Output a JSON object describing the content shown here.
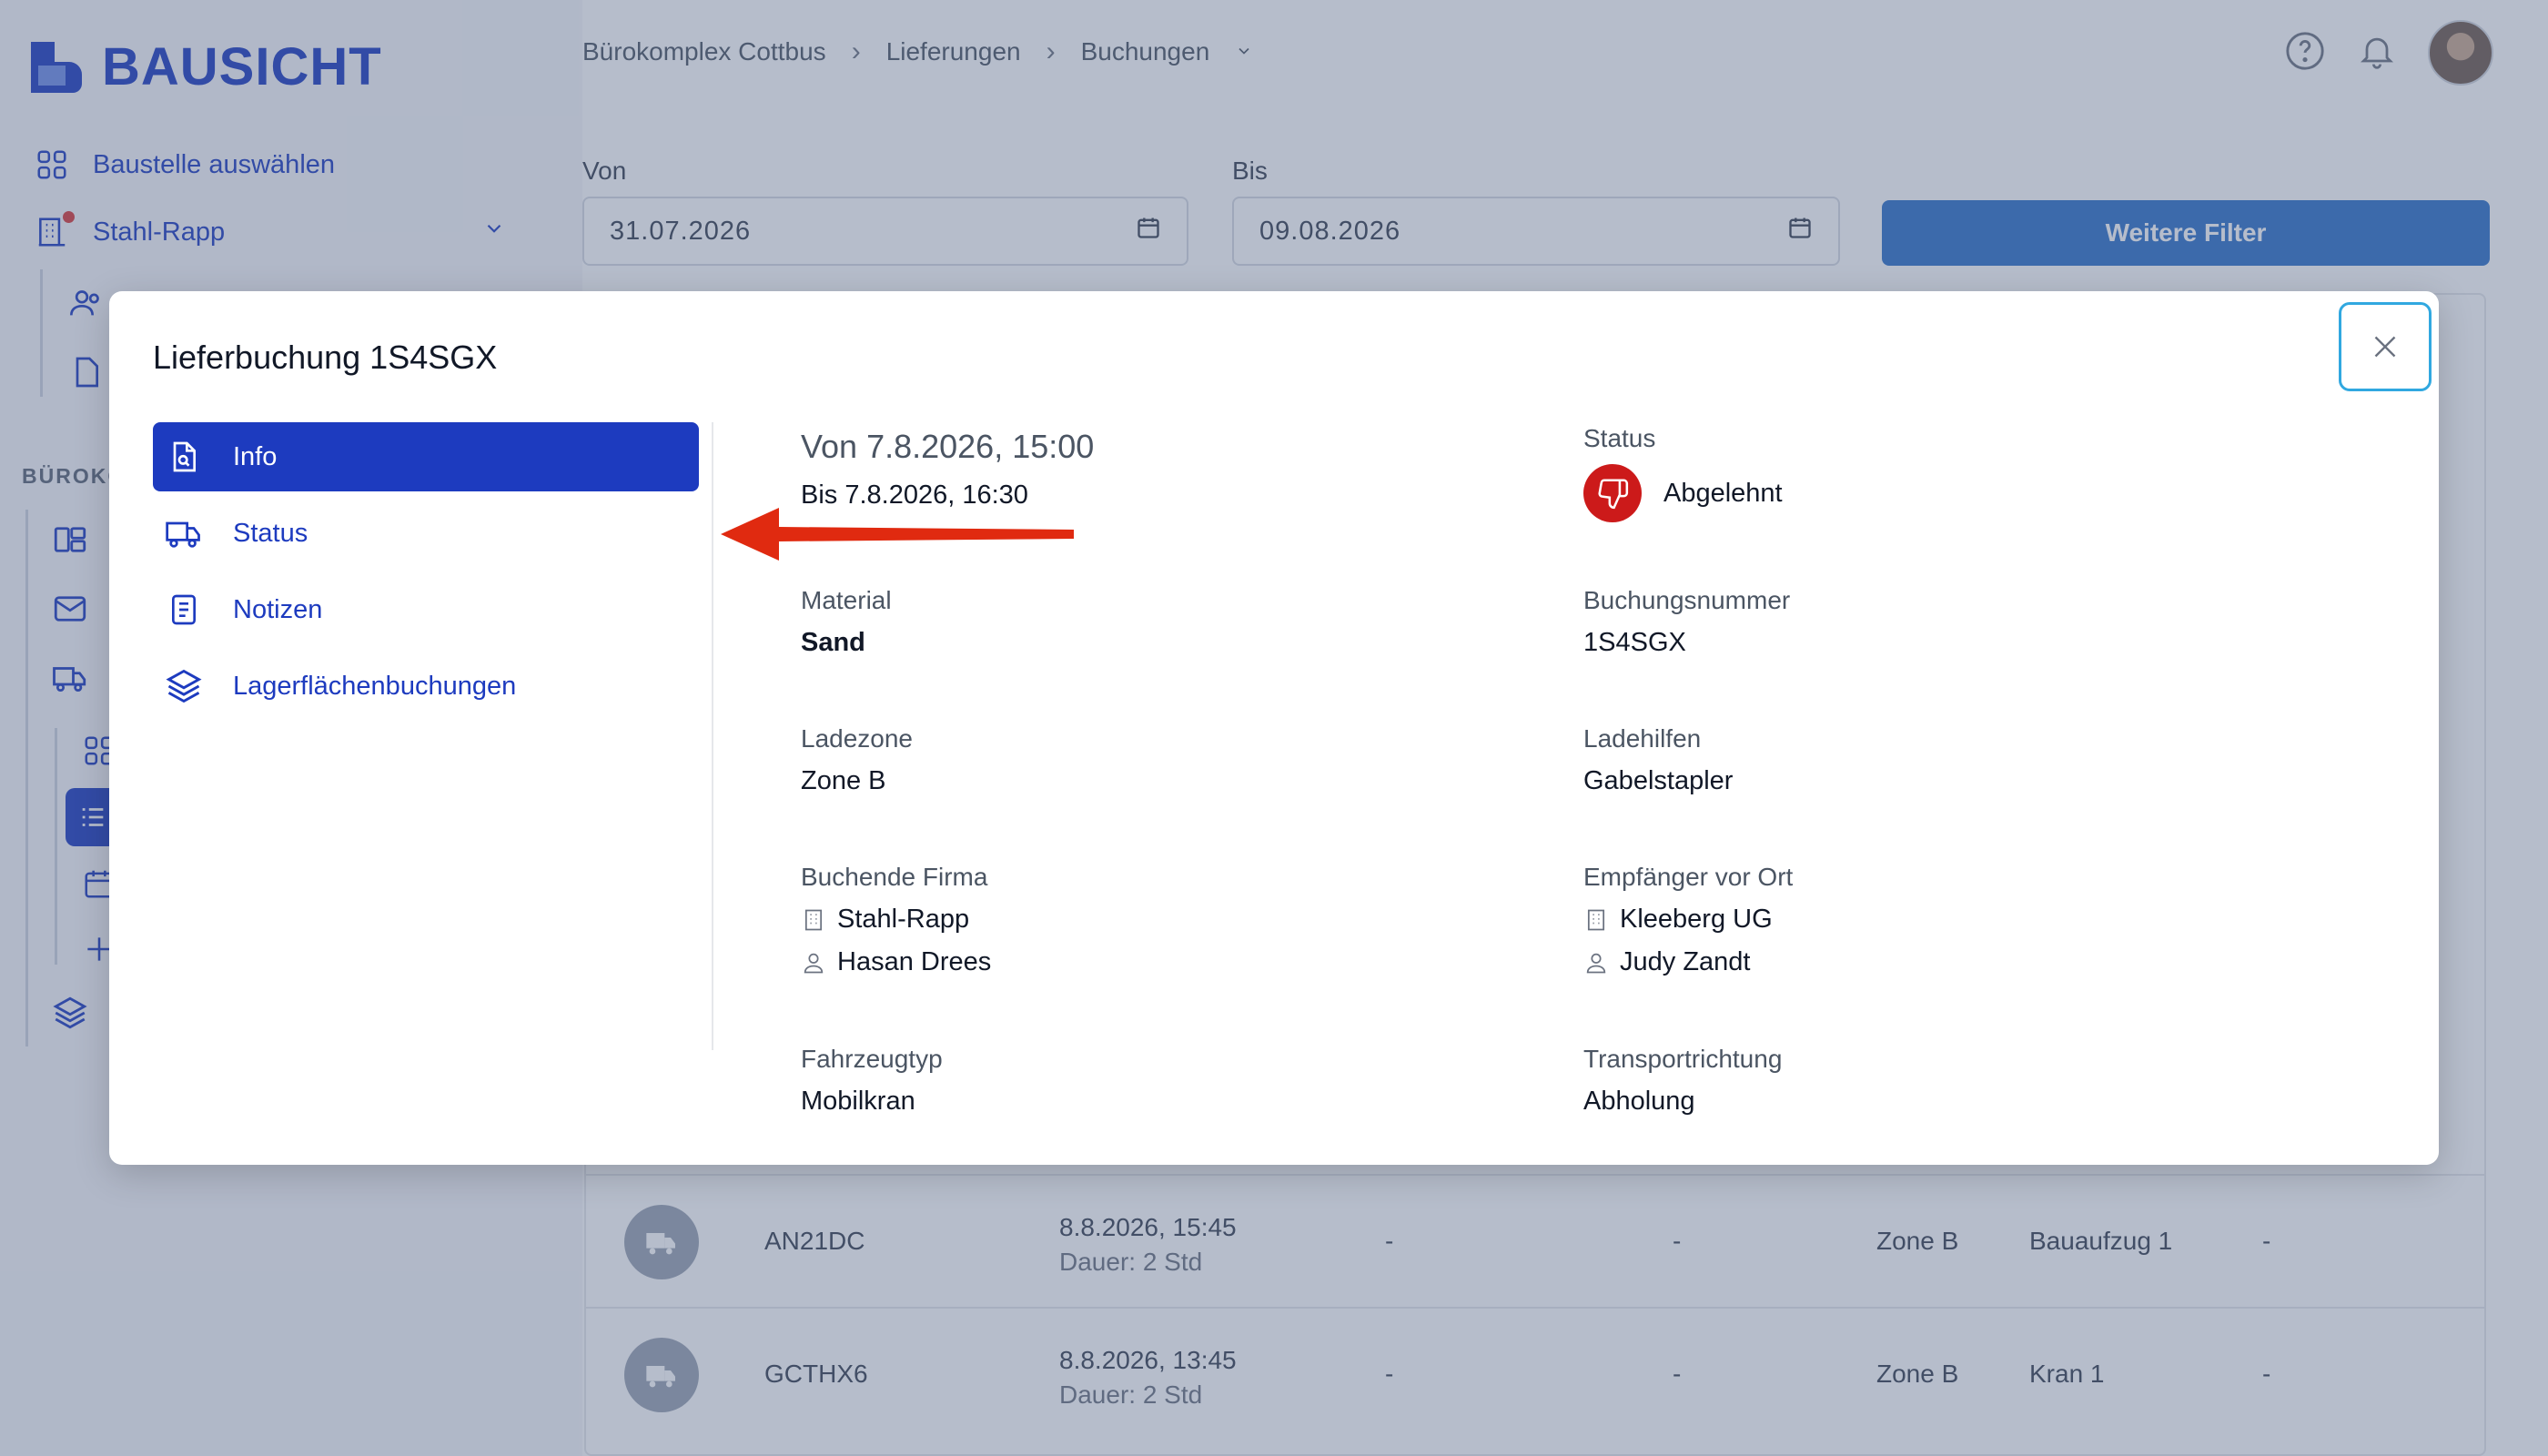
{
  "app": {
    "logo_text": "BAUSICHT",
    "brand_color": "#1d3bbf"
  },
  "sidebar": {
    "select_site": "Baustelle auswählen",
    "company": "Stahl-Rapp",
    "section": "BÜROKO"
  },
  "breadcrumb": {
    "items": [
      "Bürokomplex Cottbus",
      "Lieferungen",
      "Buchungen"
    ]
  },
  "filters": {
    "from_label": "Von",
    "from_value": "31.07.2026",
    "to_label": "Bis",
    "to_value": "09.08.2026",
    "more_filters": "Weitere Filter"
  },
  "table": {
    "rows": [
      {
        "id": "AN21DC",
        "date": "8.8.2026, 15:45",
        "duration": "Dauer: 2 Std",
        "c1": "-",
        "c2": "-",
        "zone": "Zone B",
        "device": "Bauaufzug 1",
        "c3": "-"
      },
      {
        "id": "GCTHX6",
        "date": "8.8.2026, 13:45",
        "duration": "Dauer: 2 Std",
        "c1": "-",
        "c2": "-",
        "zone": "Zone B",
        "device": "Kran 1",
        "c3": "-"
      }
    ]
  },
  "modal": {
    "title": "Lieferbuchung 1S4SGX",
    "tabs": [
      {
        "label": "Info",
        "icon": "document-search-icon",
        "active": true
      },
      {
        "label": "Status",
        "icon": "truck-icon",
        "active": false
      },
      {
        "label": "Notizen",
        "icon": "notes-icon",
        "active": false
      },
      {
        "label": "Lagerflächenbuchungen",
        "icon": "layers-icon",
        "active": false
      }
    ],
    "time_from": "Von 7.8.2026, 15:00",
    "time_to": "Bis 7.8.2026, 16:30",
    "status_label": "Status",
    "status_value": "Abgelehnt",
    "status_color": "#cc1a1a",
    "material_label": "Material",
    "material_value": "Sand",
    "booking_number_label": "Buchungsnummer",
    "booking_number_value": "1S4SGX",
    "loading_zone_label": "Ladezone",
    "loading_zone_value": "Zone B",
    "loading_aids_label": "Ladehilfen",
    "loading_aids_value": "Gabelstapler",
    "booking_company_label": "Buchende Firma",
    "booking_company_value": "Stahl-Rapp",
    "booking_person_value": "Hasan Drees",
    "recipient_label": "Empfänger vor Ort",
    "recipient_company_value": "Kleeberg UG",
    "recipient_person_value": "Judy Zandt",
    "vehicle_type_label": "Fahrzeugtyp",
    "vehicle_type_value": "Mobilkran",
    "transport_direction_label": "Transportrichtung",
    "transport_direction_value": "Abholung"
  },
  "annotation": {
    "arrow_color": "#e02a10"
  }
}
